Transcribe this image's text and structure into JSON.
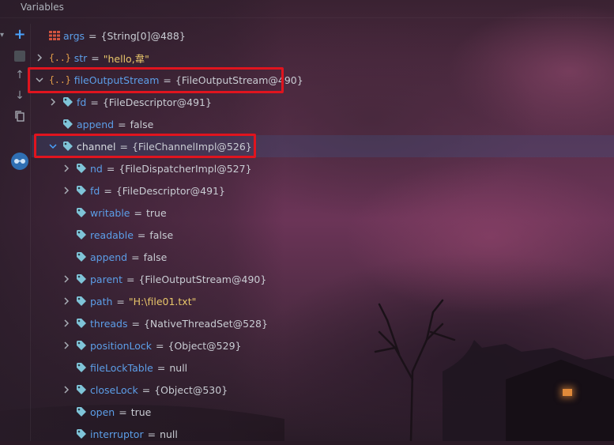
{
  "panel": {
    "title": "Variables"
  },
  "colors": {
    "name": "#5c9ee8",
    "string": "#e7c56a",
    "highlight": "#e0141e",
    "object_icon": "#e6a04a",
    "field_icon": "#7fc4d8"
  },
  "rows": [
    {
      "icon": "array-icon",
      "name": "args",
      "value": "{String[0]@488}",
      "expandable": false,
      "expanded": false
    },
    {
      "icon": "object-icon",
      "name": "str",
      "value": "\"hello,韋\"",
      "expandable": true,
      "expanded": false,
      "is_string": true
    },
    {
      "icon": "object-icon",
      "name": "fileOutputStream",
      "value": "{FileOutputStream@490}",
      "expandable": true,
      "expanded": true
    },
    {
      "icon": "field-icon",
      "name": "fd",
      "value": "{FileDescriptor@491}",
      "expandable": true,
      "expanded": false
    },
    {
      "icon": "field-icon",
      "name": "append",
      "value": "false",
      "expandable": false,
      "expanded": false
    },
    {
      "icon": "field-icon",
      "name": "channel",
      "value": "{FileChannelImpl@526}",
      "expandable": true,
      "expanded": true,
      "selected": true
    },
    {
      "icon": "field-icon",
      "name": "nd",
      "value": "{FileDispatcherImpl@527}",
      "expandable": true,
      "expanded": false
    },
    {
      "icon": "field-icon",
      "name": "fd",
      "value": "{FileDescriptor@491}",
      "expandable": true,
      "expanded": false
    },
    {
      "icon": "field-icon",
      "name": "writable",
      "value": "true",
      "expandable": false,
      "expanded": false
    },
    {
      "icon": "field-icon",
      "name": "readable",
      "value": "false",
      "expandable": false,
      "expanded": false
    },
    {
      "icon": "field-icon",
      "name": "append",
      "value": "false",
      "expandable": false,
      "expanded": false
    },
    {
      "icon": "field-icon",
      "name": "parent",
      "value": "{FileOutputStream@490}",
      "expandable": true,
      "expanded": false
    },
    {
      "icon": "field-icon",
      "name": "path",
      "value": "\"H:\\file01.txt\"",
      "expandable": true,
      "expanded": false,
      "is_string": true
    },
    {
      "icon": "field-icon",
      "name": "threads",
      "value": "{NativeThreadSet@528}",
      "expandable": true,
      "expanded": false
    },
    {
      "icon": "field-icon",
      "name": "positionLock",
      "value": "{Object@529}",
      "expandable": true,
      "expanded": false
    },
    {
      "icon": "field-icon",
      "name": "fileLockTable",
      "value": "null",
      "expandable": false,
      "expanded": false
    },
    {
      "icon": "field-icon",
      "name": "closeLock",
      "value": "{Object@530}",
      "expandable": true,
      "expanded": false
    },
    {
      "icon": "field-icon",
      "name": "open",
      "value": "true",
      "expandable": false,
      "expanded": false
    },
    {
      "icon": "field-icon",
      "name": "interruptor",
      "value": "null",
      "expandable": false,
      "expanded": false
    }
  ],
  "toolbar": [
    {
      "icon": "add-icon"
    },
    {
      "icon": "remove-icon"
    },
    {
      "icon": "arrow-up-icon"
    },
    {
      "icon": "arrow-down-icon"
    },
    {
      "icon": "copy-icon"
    },
    {
      "icon": "glasses-icon"
    }
  ]
}
